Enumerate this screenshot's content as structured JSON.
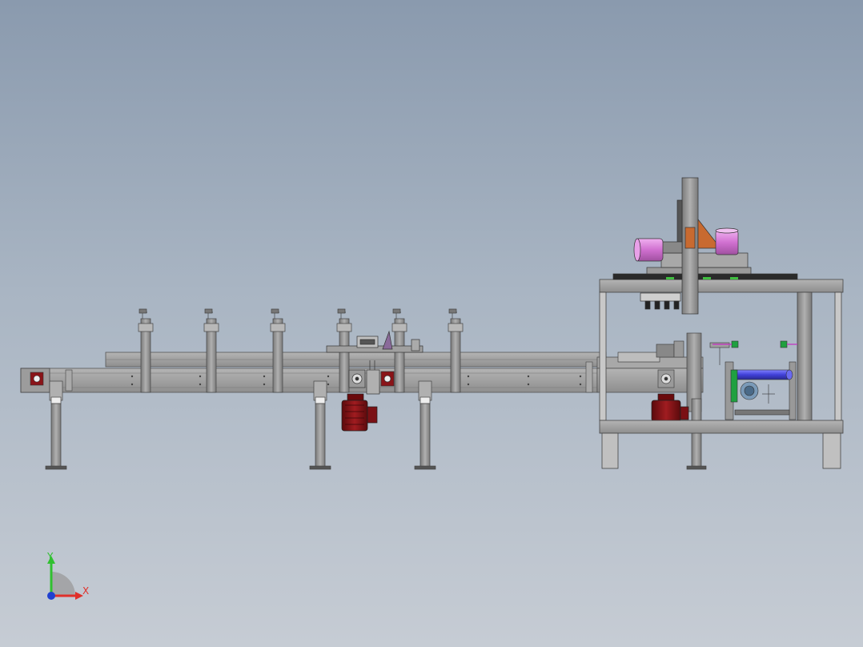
{
  "viewport": {
    "background_top": "#8a9aae",
    "background_bottom": "#c6ccd4"
  },
  "triad": {
    "x_label": "X",
    "y_label": "Y",
    "x_color": "#e0302a",
    "y_color": "#30c030",
    "z_color": "#2040d0"
  },
  "colors": {
    "frame": "#a8a8a8",
    "frame_dark": "#6e6e6e",
    "motor": "#8a1418",
    "cylinder": "#d97fd9",
    "pipe": "#5050e0",
    "sensor": "#20a040",
    "orange": "#c86a30"
  },
  "icons": [
    "coordinate-triad-icon"
  ]
}
